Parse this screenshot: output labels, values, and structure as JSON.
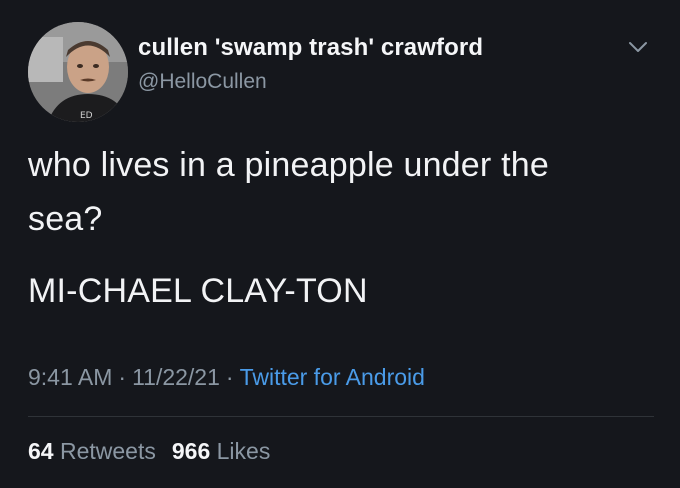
{
  "author": {
    "display_name": "cullen 'swamp trash' crawford",
    "handle": "@HelloCullen",
    "avatar_icon": "profile-photo"
  },
  "tweet": {
    "lines": [
      "who lives in a pineapple under the",
      "sea?",
      "MI-CHAEL CLAY-TON"
    ]
  },
  "meta": {
    "time": "9:41 AM",
    "separator": "·",
    "date": "11/22/21",
    "source": "Twitter for Android"
  },
  "stats": {
    "retweets_count": "64",
    "retweets_label": "Retweets",
    "likes_count": "966",
    "likes_label": "Likes"
  },
  "colors": {
    "background": "#15171c",
    "primary_text": "#f2f3f5",
    "secondary_text": "#8b97a3",
    "link": "#4a9be8"
  },
  "icons": {
    "menu": "chevron-down-icon"
  }
}
